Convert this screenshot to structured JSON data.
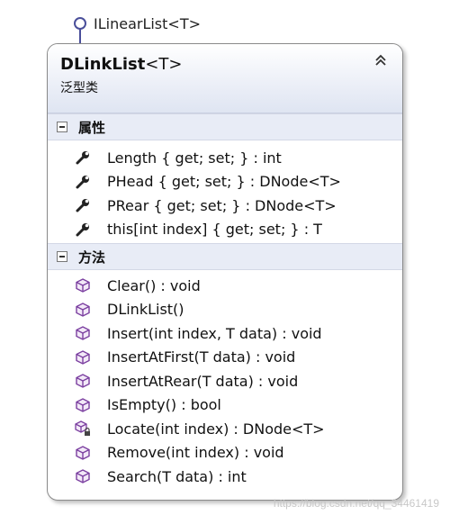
{
  "interface": {
    "label": "ILinearList<T>"
  },
  "class": {
    "name": "DLinkList",
    "type_param": "<T>",
    "kind": "泛型类"
  },
  "sections": {
    "properties": {
      "title": "属性",
      "items": [
        "Length { get; set; } : int",
        "PHead { get; set; } : DNode<T>",
        "PRear { get; set; } : DNode<T>",
        "this[int index] { get; set; } : T"
      ]
    },
    "methods": {
      "title": "方法",
      "items": [
        "Clear() : void",
        "DLinkList()",
        "Insert(int index, T data) : void",
        "InsertAtFirst(T data) : void",
        "InsertAtRear(T data) : void",
        "IsEmpty() : bool",
        "Locate(int index) : DNode<T>",
        "Remove(int index) : void",
        "Search(T data) : int"
      ]
    }
  },
  "watermark": "https://blog.csdn.net/qq_34461419",
  "colors": {
    "interface_stroke": "#4a4f9a",
    "method_icon": "#7b3fa0",
    "header_bg": "#e8ecf6"
  },
  "icons": {
    "property": "wrench-icon",
    "method": "cube-icon",
    "protected_method": "lock-cube-icon"
  }
}
